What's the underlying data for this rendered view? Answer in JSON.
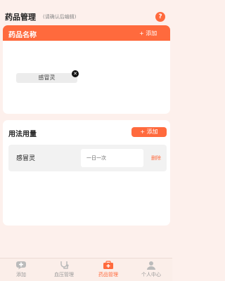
{
  "header": {
    "title": "药品管理",
    "subtitle": "(请确认后编辑)",
    "help": "?"
  },
  "drug_card": {
    "title": "药品名称",
    "add_label": "+ 添加",
    "chips": [
      {
        "name": "感冒灵",
        "close": "✕"
      }
    ]
  },
  "usage_card": {
    "title": "用法用量",
    "add_label": "+ 添加",
    "rows": [
      {
        "drug": "感冒灵",
        "dosage": "一日一次",
        "delete": "删除"
      }
    ]
  },
  "tabbar": {
    "items": [
      {
        "label": "添加",
        "icon": "plus-bubble-icon",
        "active": false
      },
      {
        "label": "血压管理",
        "icon": "stethoscope-icon",
        "active": false
      },
      {
        "label": "药品管理",
        "icon": "medicine-box-icon",
        "active": true
      },
      {
        "label": "个人中心",
        "icon": "person-icon",
        "active": false
      }
    ]
  },
  "colors": {
    "accent": "#ff6a3d",
    "background": "#fdf0ec"
  }
}
